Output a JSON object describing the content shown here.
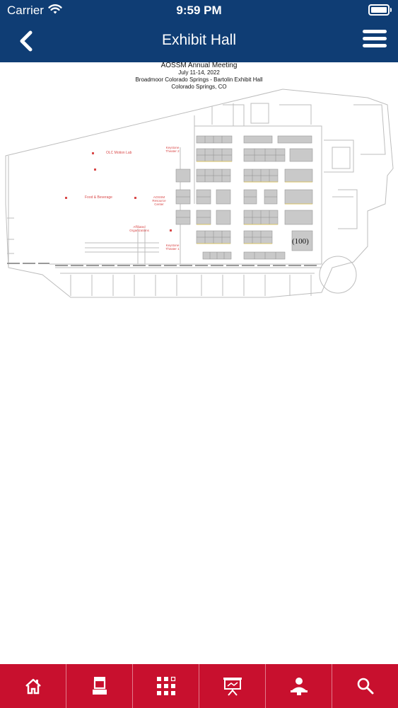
{
  "status_bar": {
    "carrier": "Carrier",
    "time": "9:59 PM"
  },
  "nav": {
    "title": "Exhibit Hall",
    "back_icon": "chevron-left-icon",
    "menu_icon": "hamburger-menu-icon"
  },
  "floor_plan": {
    "header": {
      "line1": "AOSSM Annual Meeting",
      "line2": "July 11-14, 2022",
      "line3": "Broadmoor Colorado Springs - Bartolin Exhibit Hall",
      "line4": "Colorado Springs, CO"
    },
    "labels": {
      "olc_motion_lab": "OLC Motion Lab",
      "keystone_theater_2": "Keystone Theater 2",
      "food_beverage": "Food & Beverage",
      "aossm_resource_center": "AOSSM Resource Center",
      "affiliated_organizations": "Affiliated Organizations",
      "keystone_theater_1": "Keystone Theater 1",
      "booth_100": "(100)"
    }
  },
  "tabbar": {
    "items": [
      {
        "icon": "home-icon"
      },
      {
        "icon": "kiosk-icon"
      },
      {
        "icon": "floor-grid-icon"
      },
      {
        "icon": "presentation-easel-icon"
      },
      {
        "icon": "speaker-person-icon"
      },
      {
        "icon": "search-icon"
      }
    ]
  },
  "colors": {
    "header_bg": "#0f3d74",
    "tabbar_bg": "#c8102e",
    "booth_fill": "#c9c9c9"
  }
}
